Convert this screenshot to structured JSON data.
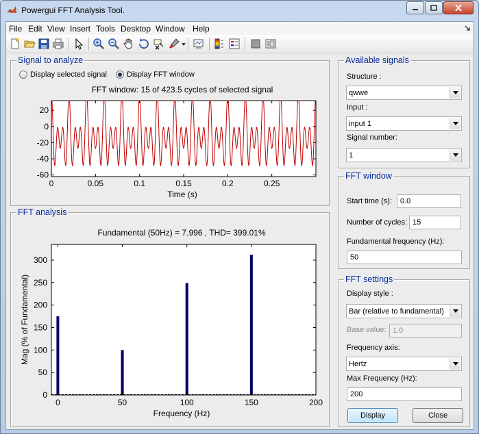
{
  "window": {
    "title": "Powergui FFT Analysis Tool."
  },
  "menubar": {
    "items": [
      "File",
      "Edit",
      "View",
      "Insert",
      "Tools",
      "Desktop",
      "Window",
      "Help"
    ]
  },
  "toolbar": {
    "icons": [
      "new-file-icon",
      "open-folder-icon",
      "save-icon",
      "print-icon",
      "pointer-icon",
      "zoom-in-icon",
      "zoom-out-icon",
      "pan-hand-icon",
      "rotate-icon",
      "data-cursor-icon",
      "brush-icon",
      "link-plot-icon",
      "colorbar-icon",
      "legend-icon",
      "hide-plot-tools-icon",
      "show-plot-tools-icon"
    ]
  },
  "signal_panel": {
    "title": "Signal to analyze",
    "radio_selected_label": "Display selected signal",
    "radio_fft_label": "Display FFT window",
    "radio_fft_selected": true,
    "plot_title": "FFT window: 15 of 423.5 cycles of selected signal",
    "xlabel": "Time (s)",
    "x_ticks": [
      "0",
      "0.05",
      "0.1",
      "0.15",
      "0.2",
      "0.25"
    ],
    "y_ticks": [
      "20",
      "0",
      "-20",
      "-40",
      "-60"
    ],
    "line_color": "#c00000"
  },
  "fft_panel": {
    "title": "FFT analysis",
    "plot_title": "Fundamental (50Hz) = 7.996 , THD= 399.01%",
    "xlabel": "Frequency (Hz)",
    "ylabel": "Mag (% of Fundamental)",
    "x_ticks": [
      "0",
      "50",
      "100",
      "150",
      "200"
    ],
    "y_ticks": [
      "0",
      "50",
      "100",
      "150",
      "200",
      "250",
      "300"
    ],
    "bar_color": "#000066"
  },
  "chart_data": [
    {
      "type": "line",
      "title": "FFT window: 15 of 423.5 cycles of selected signal",
      "xlabel": "Time (s)",
      "ylabel": "",
      "xlim": [
        0,
        0.3
      ],
      "ylim": [
        -62,
        32
      ],
      "grid": false,
      "series": [
        {
          "description": "periodic multi-harmonic waveform, 50 Hz fundamental with strong 150 Hz and 100 Hz components; peaks near 30, troughs near -60",
          "components": [
            {
              "freq_hz": 0,
              "amplitude": -14.0
            },
            {
              "freq_hz": 50,
              "amplitude": 8.0
            },
            {
              "freq_hz": 100,
              "amplitude": 20.0
            },
            {
              "freq_hz": 150,
              "amplitude": 25.0
            }
          ]
        }
      ]
    },
    {
      "type": "bar",
      "title": "Fundamental (50Hz) = 7.996 , THD= 399.01%",
      "xlabel": "Frequency (Hz)",
      "ylabel": "Mag (% of Fundamental)",
      "xlim": [
        -5,
        200
      ],
      "ylim": [
        0,
        335
      ],
      "x": [
        0,
        50,
        100,
        150
      ],
      "values": [
        175,
        100,
        249,
        312
      ]
    }
  ],
  "available_signals": {
    "title": "Available signals",
    "structure_label": "Structure :",
    "structure_value": "qwwe",
    "input_label": "Input :",
    "input_value": "input 1",
    "signal_number_label": "Signal number:",
    "signal_number_value": "1"
  },
  "fft_window": {
    "title": "FFT window",
    "start_time_label": "Start time (s):",
    "start_time_value": "0.0",
    "cycles_label": "Number of cycles:",
    "cycles_value": "15",
    "fund_freq_label": "Fundamental frequency (Hz):",
    "fund_freq_value": "50"
  },
  "fft_settings": {
    "title": "FFT settings",
    "display_style_label": "Display style :",
    "display_style_value": "Bar (relative to fundamental)",
    "base_value_label": "Base value:",
    "base_value_value": "1.0",
    "freq_axis_label": "Frequency axis:",
    "freq_axis_value": "Hertz",
    "max_freq_label": "Max Frequency (Hz):",
    "max_freq_value": "200"
  },
  "buttons": {
    "display_label": "Display",
    "close_label": "Close"
  }
}
